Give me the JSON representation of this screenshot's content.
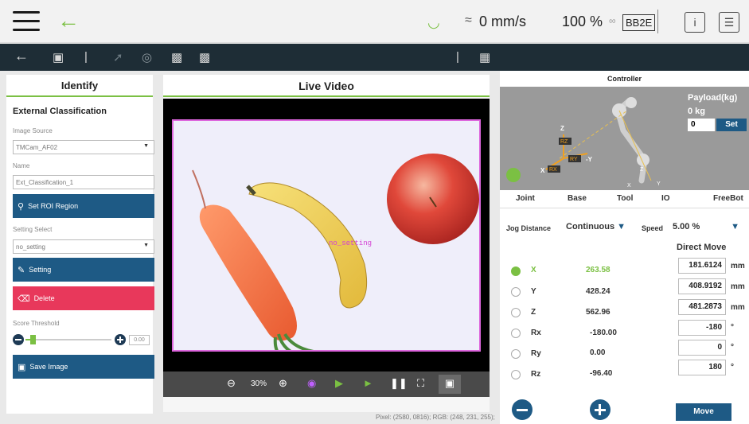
{
  "topbar": {
    "speed": "0 mm/s",
    "percent": "100 %",
    "badge": "BB2E"
  },
  "left": {
    "title": "Identify",
    "section": "External Classification",
    "image_source_label": "Image Source",
    "image_source_value": "TMCam_AF02",
    "name_label": "Name",
    "name_value": "Ext_Classification_1",
    "roi_button": "Set ROI Region",
    "setting_select_label": "Setting Select",
    "setting_select_value": "no_setting",
    "setting_button": "Setting",
    "delete_button": "Delete",
    "score_label": "Score Threshold",
    "score_value": "0.00",
    "save_button": "Save Image"
  },
  "center": {
    "title": "Live Video",
    "overlay_label": "no_setting",
    "zoom": "30%",
    "pixel_info": "Pixel: (2580, 0816); RGB: (248, 231, 255);"
  },
  "controller": {
    "title": "Controller",
    "payload_label": "Payload(kg)",
    "payload_value": "0 kg",
    "payload_input": "0",
    "set_button": "Set",
    "axis_labels": [
      "Z",
      "RZ",
      "RY",
      "-Y",
      "X",
      "RX",
      "Z",
      "Y",
      "X"
    ],
    "tabs": [
      "Joint",
      "Base",
      "Tool",
      "IO",
      "FreeBot"
    ],
    "jog_label": "Jog Distance",
    "jog_value": "Continuous",
    "speed_label": "Speed",
    "speed_value": "5.00 %",
    "direct_move": "Direct Move",
    "rows": [
      {
        "axis": "X",
        "value": "263.58",
        "target": "181.6124",
        "unit": "mm"
      },
      {
        "axis": "Y",
        "value": "428.24",
        "target": "408.9192",
        "unit": "mm"
      },
      {
        "axis": "Z",
        "value": "562.96",
        "target": "481.2873",
        "unit": "mm"
      },
      {
        "axis": "Rx",
        "value": "-180.00",
        "target": "-180",
        "unit": "°"
      },
      {
        "axis": "Ry",
        "value": "0.00",
        "target": "0",
        "unit": "°"
      },
      {
        "axis": "Rz",
        "value": "-96.40",
        "target": "180",
        "unit": "°"
      }
    ],
    "move_button": "Move"
  }
}
